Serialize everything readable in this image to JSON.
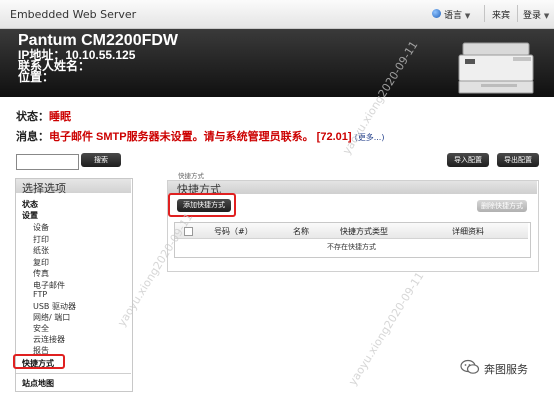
{
  "topbar": {
    "title": "Embedded Web Server",
    "language": "语言",
    "welcome": "来宾",
    "login": "登录"
  },
  "header": {
    "model": "Pantum CM2200FDW",
    "ip": "IP地址：10.10.55.125",
    "contact": "联系人姓名：",
    "location": "位置："
  },
  "status": {
    "label": "状态：",
    "value": "睡眠",
    "msg_label": "消息：",
    "msg_value": "电子邮件 SMTP服务器未设置。请与系统管理员联系。 [72.01]",
    "more": "(更多...)"
  },
  "search": {
    "button": "搜索",
    "placeholder": ""
  },
  "config": {
    "import": "导入配置",
    "export": "导出配置"
  },
  "sidebar": {
    "title": "选择选项",
    "items": [
      {
        "label": "状态"
      },
      {
        "label": "设置"
      },
      {
        "label": "设备"
      },
      {
        "label": "打印"
      },
      {
        "label": "纸张"
      },
      {
        "label": "复印"
      },
      {
        "label": "传真"
      },
      {
        "label": "电子邮件"
      },
      {
        "label": "FTP"
      },
      {
        "label": "USB 驱动器"
      },
      {
        "label": "网络/ 端口"
      },
      {
        "label": "安全"
      },
      {
        "label": "云连接器"
      },
      {
        "label": "报告"
      },
      {
        "label": "快捷方式"
      },
      {
        "label": "站点地图"
      }
    ]
  },
  "main": {
    "breadcrumb": "快捷方式",
    "title": "快捷方式",
    "add_button": "添加快捷方式",
    "delete_button": "删除快捷方式",
    "columns": [
      "号码（#）",
      "名称",
      "快捷方式类型",
      "详细资料"
    ],
    "empty": "不存在快捷方式"
  },
  "watermarks": [
    "yaoyu.xiong2020-09-11",
    "yaoyu.xiong2020-09-11",
    "yaoyu.xiong2020-09-11"
  ],
  "wechat": "奔图服务",
  "colors": {
    "red": "#cc0000",
    "link": "#1f3c88",
    "highlight": "#e02020",
    "header_bg": "#1a1a1a"
  }
}
